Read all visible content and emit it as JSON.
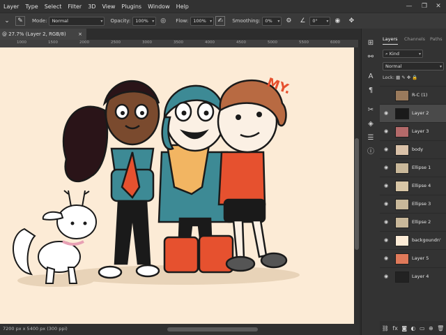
{
  "menu": {
    "items": [
      "Layer",
      "Type",
      "Select",
      "Filter",
      "3D",
      "View",
      "Plugins",
      "Window",
      "Help"
    ]
  },
  "window_controls": {
    "minimize": "—",
    "restore": "❐",
    "close": "✕"
  },
  "options_bar": {
    "mode_label": "Mode:",
    "mode_value": "Normal",
    "opacity_label": "Opacity:",
    "opacity_value": "100%",
    "flow_label": "Flow:",
    "flow_value": "100%",
    "smoothing_label": "Smoothing:",
    "smoothing_value": "0%",
    "angle_value": "0°"
  },
  "document": {
    "tab_title": "@ 27.7% (Layer 2, RGB/8)",
    "close": "×"
  },
  "ruler": {
    "marks": [
      "1000",
      "1500",
      "2000",
      "2500",
      "3000",
      "3500",
      "4000",
      "4500",
      "5000",
      "5500",
      "6000"
    ]
  },
  "status": {
    "text": "7200 px x 5400 px (300 ppi)"
  },
  "canvas": {
    "annotation": "MY."
  },
  "panel": {
    "tabs": [
      "Layers",
      "Channels",
      "Paths"
    ],
    "kind_filter": "Kind",
    "blend_mode": "Normal",
    "lock_label": "Lock:",
    "layers": [
      {
        "name": "R-C (1)",
        "visible": false,
        "thumb": "#9a7a5c"
      },
      {
        "name": "Layer 2",
        "visible": true,
        "thumb": "#1a1a1a",
        "selected": true
      },
      {
        "name": "Layer 3",
        "visible": true,
        "thumb": "#b46a6a"
      },
      {
        "name": "body",
        "visible": true,
        "thumb": "#d9c1a8"
      },
      {
        "name": "Ellipse 1",
        "visible": true,
        "thumb": "#c9b89a"
      },
      {
        "name": "Ellipse 4",
        "visible": true,
        "thumb": "#d8c6a6"
      },
      {
        "name": "Ellipse 3",
        "visible": true,
        "thumb": "#c9b89a"
      },
      {
        "name": "Ellipse 2",
        "visible": true,
        "thumb": "#c9b89a"
      },
      {
        "name": "backgoundn'",
        "visible": true,
        "thumb": "#fcebd6"
      },
      {
        "name": "Layer 5",
        "visible": true,
        "thumb": "#e07a5a"
      },
      {
        "name": "Layer 4",
        "visible": true,
        "thumb": "#222222"
      }
    ],
    "footer_icons": [
      "link-icon",
      "fx-icon",
      "mask-icon",
      "adjustment-icon",
      "folder-icon",
      "new-layer-icon",
      "trash-icon"
    ]
  },
  "colors": {
    "canvas_bg": "#fcebd6",
    "panel_bg": "#333333",
    "accent": "#e6512f"
  }
}
